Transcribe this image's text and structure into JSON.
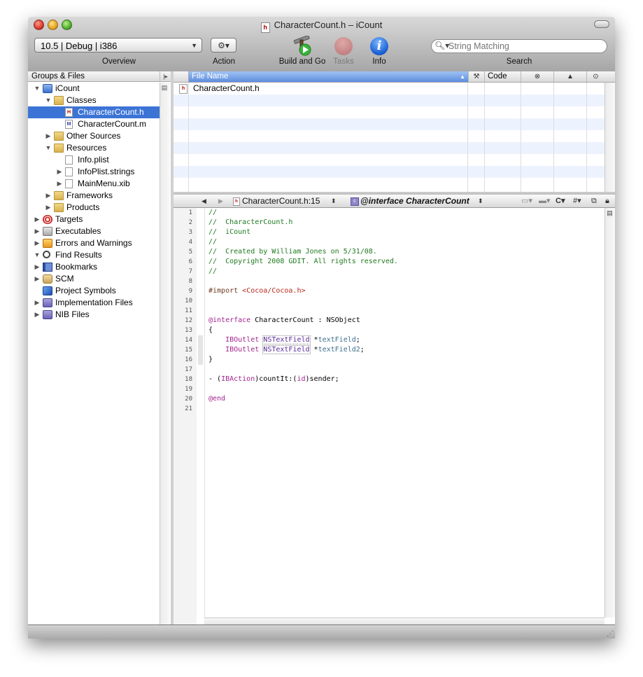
{
  "window": {
    "title": "CharacterCount.h – iCount",
    "title_doc_letter": "h"
  },
  "toolbar": {
    "overview_value": "10.5 | Debug | i386",
    "overview_label": "Overview",
    "action_glyph": "⚙▾",
    "action_label": "Action",
    "build_label": "Build and Go",
    "tasks_label": "Tasks",
    "info_label": "Info",
    "info_glyph": "i",
    "search_placeholder": "String Matching",
    "search_label": "Search"
  },
  "sidebar": {
    "header": "Groups & Files",
    "items": [
      {
        "label": "iCount",
        "disclosure": "▼",
        "icon": "blue"
      },
      {
        "label": "Classes",
        "disclosure": "▼",
        "icon": "folder"
      },
      {
        "label": "CharacterCount.h",
        "disclosure": "",
        "icon": "file-h",
        "selected": true
      },
      {
        "label": "CharacterCount.m",
        "disclosure": "",
        "icon": "file-m"
      },
      {
        "label": "Other Sources",
        "disclosure": "▶",
        "icon": "folder"
      },
      {
        "label": "Resources",
        "disclosure": "▼",
        "icon": "folder"
      },
      {
        "label": "Info.plist",
        "disclosure": "",
        "icon": "file"
      },
      {
        "label": "InfoPlist.strings",
        "disclosure": "▶",
        "icon": "file"
      },
      {
        "label": "MainMenu.xib",
        "disclosure": "▶",
        "icon": "file"
      },
      {
        "label": "Frameworks",
        "disclosure": "▶",
        "icon": "folder"
      },
      {
        "label": "Products",
        "disclosure": "▶",
        "icon": "folder"
      },
      {
        "label": "Targets",
        "disclosure": "▶",
        "icon": "target"
      },
      {
        "label": "Executables",
        "disclosure": "▶",
        "icon": "executables"
      },
      {
        "label": "Errors and Warnings",
        "disclosure": "▶",
        "icon": "warn"
      },
      {
        "label": "Find Results",
        "disclosure": "▼",
        "icon": "find"
      },
      {
        "label": "Bookmarks",
        "disclosure": "▶",
        "icon": "book"
      },
      {
        "label": "SCM",
        "disclosure": "▶",
        "icon": "scm"
      },
      {
        "label": "Project Symbols",
        "disclosure": "",
        "icon": "cube"
      },
      {
        "label": "Implementation Files",
        "disclosure": "▶",
        "icon": "smart"
      },
      {
        "label": "NIB Files",
        "disclosure": "▶",
        "icon": "smart"
      }
    ]
  },
  "filelist": {
    "columns": {
      "file_name": "File Name",
      "code": "Code"
    },
    "rows": [
      {
        "name": "CharacterCount.h",
        "icon_letter": "h"
      }
    ]
  },
  "navbar": {
    "file": "CharacterCount.h:15",
    "symbol": "@interface CharacterCount",
    "symbol_icon_letter": "c",
    "counterparts_label": "C▾",
    "includes_label": "#▾"
  },
  "editor": {
    "lines": [
      "//",
      "//  CharacterCount.h",
      "//  iCount",
      "//",
      "//  Created by William Jones on 5/31/08.",
      "//  Copyright 2008 GDIT. All rights reserved.",
      "//",
      "",
      "#import <Cocoa/Cocoa.h>",
      "",
      "",
      "@interface CharacterCount : NSObject",
      "{",
      "    IBOutlet NSTextField *textField;",
      "    IBOutlet NSTextField *textField2;",
      "}",
      "",
      "- (IBAction)countIt:(id)sender;",
      "",
      "@end",
      ""
    ]
  },
  "colors": {
    "selection": "#3c74d6",
    "comment": "#1f7a1f",
    "keyword": "#a3248f",
    "string": "#b8281b",
    "row_alt": "#edf3fe"
  }
}
